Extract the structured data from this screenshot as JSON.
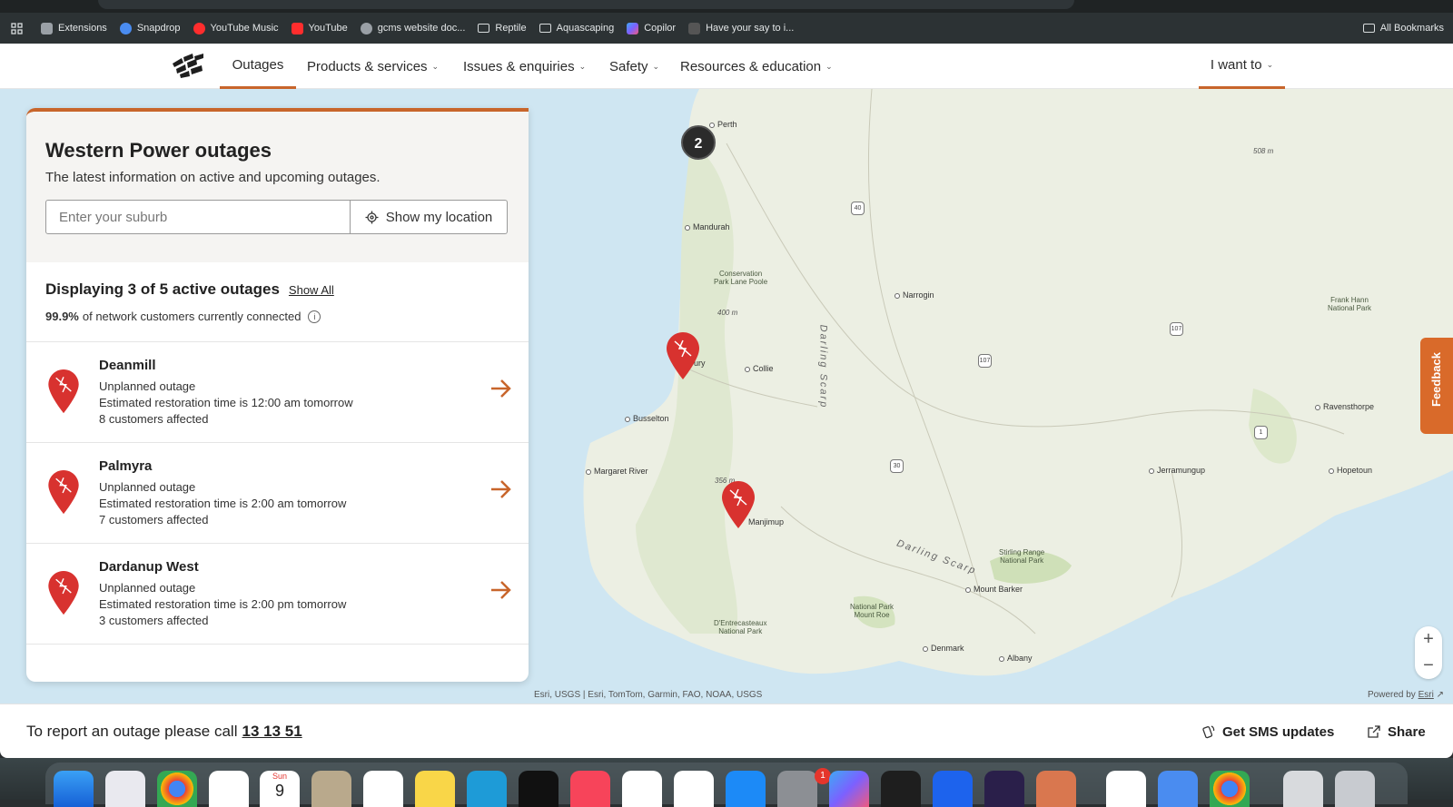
{
  "browser": {
    "bookmarks": [
      {
        "label": "Extensions",
        "color": "#9aa0a6"
      },
      {
        "label": "Snapdrop",
        "color": "#4a8cf0"
      },
      {
        "label": "YouTube Music",
        "color": "#ff2d2d"
      },
      {
        "label": "YouTube",
        "color": "#ff2d2d"
      },
      {
        "label": "gcms website doc...",
        "color": "#9aa0a6"
      },
      {
        "label": "Reptile",
        "color": "folder"
      },
      {
        "label": "Aquascaping",
        "color": "folder"
      },
      {
        "label": "Copilor",
        "color": "#7b61ff"
      },
      {
        "label": "Have your say to i...",
        "color": "#555555"
      }
    ],
    "all_bookmarks": "All Bookmarks"
  },
  "nav": {
    "items": [
      "Outages",
      "Products & services",
      "Issues & enquiries",
      "Safety",
      "Resources & education"
    ],
    "i_want_to": "I want to",
    "active_color": "#c8652b"
  },
  "panel": {
    "title": "Western Power outages",
    "subtitle": "The latest information on active and upcoming outages.",
    "search_placeholder": "Enter your suburb",
    "location_button": "Show my location",
    "summary_title": "Displaying 3 of 5 active outages",
    "show_all": "Show All",
    "connected_pct": "99.9%",
    "connected_text": "of network customers currently connected",
    "outages": [
      {
        "name": "Deanmill",
        "type": "Unplanned outage",
        "restore": "Estimated restoration time is 12:00 am tomorrow",
        "affected": "8 customers affected"
      },
      {
        "name": "Palmyra",
        "type": "Unplanned outage",
        "restore": "Estimated restoration time is 2:00 am tomorrow",
        "affected": "7 customers affected"
      },
      {
        "name": "Dardanup West",
        "type": "Unplanned outage",
        "restore": "Estimated restoration time is 2:00 pm tomorrow",
        "affected": "3 customers affected"
      }
    ]
  },
  "map": {
    "cluster_count": "2",
    "places": {
      "perth": "Perth",
      "mandurah": "Mandurah",
      "narrogin": "Narrogin",
      "collie": "Collie",
      "bunbury": "ury",
      "busselton": "Busselton",
      "margaret_river": "Margaret River",
      "manjimup": "Manjimup",
      "mount_barker": "Mount Barker",
      "denmark": "Denmark",
      "albany": "Albany",
      "jerramungup": "Jerramungup",
      "hopetoun": "Hopetoun",
      "ravensthorpe": "Ravensthorpe"
    },
    "parks": {
      "lane_poole": "Conservation\nPark Lane Poole",
      "frank_hann": "Frank Hann\nNational Park",
      "stirling": "Stirling Range\nNational Park",
      "mount_roe": "National Park\nMount Roe",
      "dentrecasteaux": "D'Entrecasteaux\nNational Park"
    },
    "elevations": {
      "e508": "508 m",
      "e400": "400 m",
      "e356": "356 m"
    },
    "scarp_1": "Darling Scarp",
    "scarp_2": "Darling Scarp",
    "shields": {
      "s40": "40",
      "s107a": "107",
      "s107b": "107",
      "s1": "1",
      "s30": "30"
    },
    "attribution": "Esri, USGS | Esri, TomTom, Garmin, FAO, NOAA, USGS",
    "powered_by": "Powered by",
    "powered_link": "Esri",
    "zoom_in": "+",
    "zoom_out": "−",
    "feedback": "Feedback"
  },
  "footer": {
    "report_text": "To report an outage please call",
    "report_number": "13 13 51",
    "sms": "Get SMS updates",
    "share": "Share"
  },
  "dock": {
    "calendar_month": "Sun",
    "calendar_day": "9",
    "settings_badge": "1"
  }
}
